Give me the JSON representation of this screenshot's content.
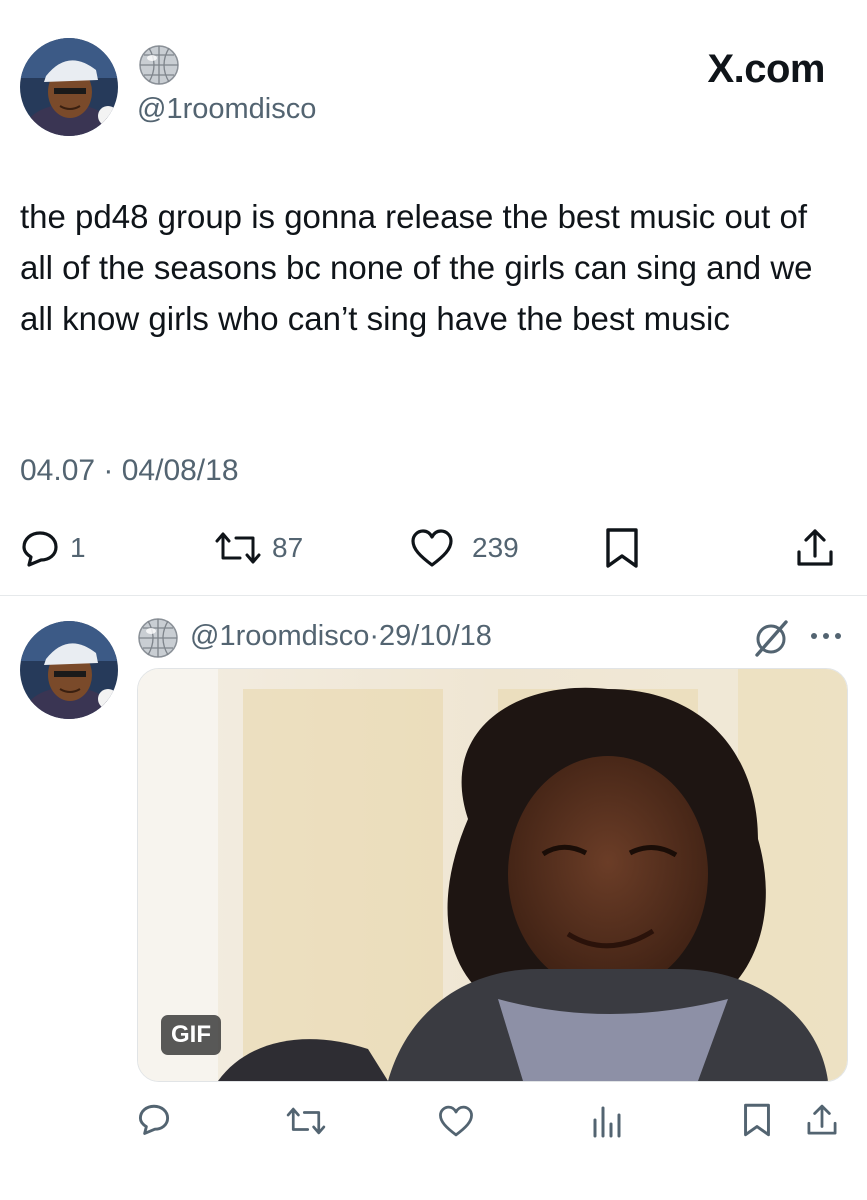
{
  "brand": {
    "label": "X.com"
  },
  "main_tweet": {
    "handle": "@1roomdisco",
    "text": "the pd48 group is gonna release the best music out of all of the seasons bc none of the girls can sing and we all know girls who can’t sing have the best music",
    "timestamp": "04.07 · 04/08/18",
    "actions": {
      "reply_count": "1",
      "retweet_count": "87",
      "like_count": "239"
    }
  },
  "reply_tweet": {
    "handle": "@1roomdisco",
    "separator": "·",
    "date": "29/10/18",
    "media": {
      "badge": "GIF"
    }
  },
  "icons": {
    "avatar": "avatar-cartoon-icon",
    "disco_ball": "disco-ball-icon",
    "reply": "reply-bubble-icon",
    "retweet": "retweet-icon",
    "like": "heart-icon",
    "bookmark": "bookmark-icon",
    "share": "share-icon",
    "views": "views-bar-icon",
    "grok": "grok-slash-circle-icon",
    "more": "more-dots-icon"
  },
  "colors": {
    "text": "#0f1419",
    "secondary": "#536471",
    "divider": "#e6e9eb"
  }
}
